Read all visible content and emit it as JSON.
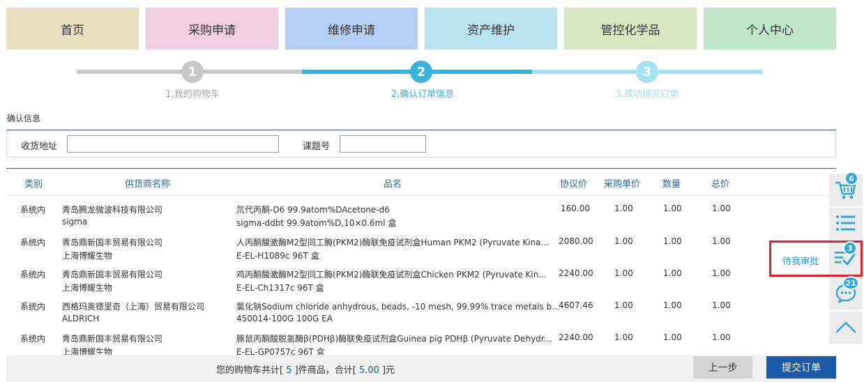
{
  "nav": [
    {
      "label": "首页",
      "color": "#e8dfbf"
    },
    {
      "label": "采购申请",
      "color": "#f0d0e0"
    },
    {
      "label": "维修申请",
      "color": "#b5cff5"
    },
    {
      "label": "资产维护",
      "color": "#b8e4ef"
    },
    {
      "label": "管控化学品",
      "color": "#d8e6c2"
    },
    {
      "label": "个人中心",
      "color": "#bfe6c8"
    }
  ],
  "steps": [
    {
      "num": "1",
      "label": "1,我的购物车",
      "color": "#c8c8c8",
      "text_color": "#aaaaaa"
    },
    {
      "num": "2",
      "label": "2,确认订单信息",
      "color": "#3ab3dc",
      "text_color": "#3ab3dc"
    },
    {
      "num": "3",
      "label": "3,成功提交订单",
      "color": "#a4e1f2",
      "text_color": "#a4e1f2"
    }
  ],
  "confirm": {
    "title": "确认信息",
    "address_label": "收货地址",
    "address_value": "",
    "project_label": "课题号",
    "project_value": ""
  },
  "table": {
    "headers": [
      "类别",
      "供货商名称",
      "品名",
      "协议价",
      "采购单价",
      "数量",
      "总价"
    ],
    "rows": [
      {
        "category": "系统内",
        "supplier": "青岛腾龙微波科技有限公司",
        "brand": "sigma",
        "product": "氘代丙酮-D6 99.9atom%DAcetone-d6",
        "spec": "sigma-ddbt 99.9atom%D,10×0.6ml 盒",
        "price": "160.00",
        "unit": "1.00",
        "qty": "1.00",
        "total": "1.00"
      },
      {
        "category": "系统内",
        "supplier": "青岛鼎新国丰贸易有限公司",
        "brand": "上海博耀生物",
        "product": "人丙酮酸激酶M2型同工酶(PKM2)酶联免疫试剂盒Human PKM2 (Pyruvate Kina...",
        "spec": "E-EL-H1089c 96T 盒",
        "price": "2080.00",
        "unit": "1.00",
        "qty": "1.00",
        "total": "1.00"
      },
      {
        "category": "系统内",
        "supplier": "青岛鼎新国丰贸易有限公司",
        "brand": "上海博耀生物",
        "product": "鸡丙酮酸激酶M2型同工酶(PKM2)酶联免疫试剂盒Chicken PKM2 (Pyruvate Kin...",
        "spec": "E-EL-Ch1317c 96T 盒",
        "price": "2240.00",
        "unit": "1.00",
        "qty": "1.00",
        "total": "1.00"
      },
      {
        "category": "系统内",
        "supplier": "西格玛奥德里奇（上海）贸易有限公司",
        "brand": "ALDRICH",
        "product": "氯化钠Sodium chloride anhydrous, beads, -10 mesh, 99.99% trace metals b...",
        "spec": "450014-100G 100G EA",
        "price": "4607.46",
        "unit": "1.00",
        "qty": "1.00",
        "total": "1.00"
      },
      {
        "category": "系统内",
        "supplier": "青岛鼎新国丰贸易有限公司",
        "brand": "上海博耀生物",
        "product": "豚鼠丙酮酸脱氢酶β(PDHβ)酶联免疫试剂盒Guinea pig PDHβ (Pyruvate Dehydr...",
        "spec": "E-EL-GP0757c 96T 盒",
        "price": "2240.00",
        "unit": "1.00",
        "qty": "1.00",
        "total": "1.00"
      }
    ]
  },
  "footer": {
    "summary_prefix": "您的购物车共计[",
    "count": " 5 ",
    "summary_mid": "]件商品，合计[",
    "amount": " 5.00 ",
    "summary_suffix": "]元",
    "prev_label": "上一步",
    "submit_label": "提交订单"
  },
  "sidebar": {
    "cart_badge": "6",
    "approve_badge": "3",
    "chat_badge": "21",
    "approve_label": "待我审批",
    "accent": "#29a9df"
  }
}
